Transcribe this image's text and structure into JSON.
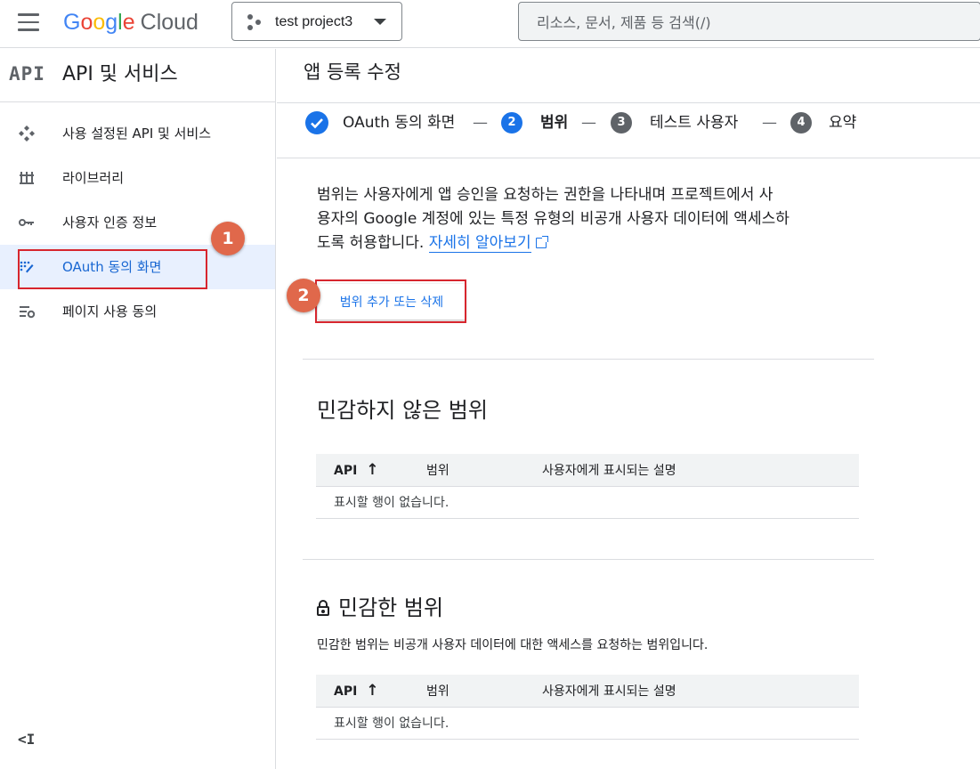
{
  "header": {
    "logo": {
      "g1": "G",
      "g2": "o",
      "g3": "o",
      "g4": "g",
      "g5": "l",
      "g6": "e",
      "product": "Cloud"
    },
    "project": "test project3",
    "search_placeholder": "리소스, 문서, 제품 등 검색(/)"
  },
  "sidebar": {
    "logo_text": "API",
    "title": "API 및 서비스",
    "items": [
      {
        "label": "사용 설정된 API 및 서비스",
        "icon": "api-services-icon"
      },
      {
        "label": "라이브러리",
        "icon": "library-icon"
      },
      {
        "label": "사용자 인증 정보",
        "icon": "key-icon"
      },
      {
        "label": "OAuth 동의 화면",
        "icon": "oauth-consent-icon",
        "active": true
      },
      {
        "label": "페이지 사용 동의",
        "icon": "page-settings-icon"
      }
    ],
    "collapse_icon": "<I"
  },
  "callouts": {
    "first": "1",
    "second": "2"
  },
  "main": {
    "title": "앱 등록 수정",
    "steps": [
      {
        "label": "OAuth 동의 화면",
        "state": "done"
      },
      {
        "num": "2",
        "label": "범위",
        "state": "current"
      },
      {
        "num": "3",
        "label": "테스트 사용자",
        "state": "pending"
      },
      {
        "num": "4",
        "label": "요약",
        "state": "pending"
      }
    ],
    "step_separator": "—",
    "description": {
      "line1": "범위는 사용자에게 앱 승인을 요청하는 권한을 나타내며 프로젝트에서 사",
      "line2": "용자의 Google 계정에 있는 특정 유형의 비공개 사용자 데이터에 액세스하",
      "line3": "도록 허용합니다.",
      "link": "자세히 알아보기"
    },
    "scope_button": "범위 추가 또는 삭제",
    "non_sensitive": {
      "title": "민감하지 않은 범위",
      "columns": {
        "api": "API",
        "scope": "범위",
        "desc": "사용자에게 표시되는 설명"
      },
      "empty": "표시할 행이 없습니다."
    },
    "sensitive": {
      "title": "민감한 범위",
      "subtitle": "민감한 범위는 비공개 사용자 데이터에 대한 액세스를 요청하는 범위입니다.",
      "columns": {
        "api": "API",
        "scope": "범위",
        "desc": "사용자에게 표시되는 설명"
      },
      "empty": "표시할 행이 없습니다."
    }
  },
  "colors": {
    "accent": "#1a73e8",
    "callout": "#e0684b",
    "highlight_box": "#d7262e",
    "active_bg": "#e8f0fe"
  }
}
